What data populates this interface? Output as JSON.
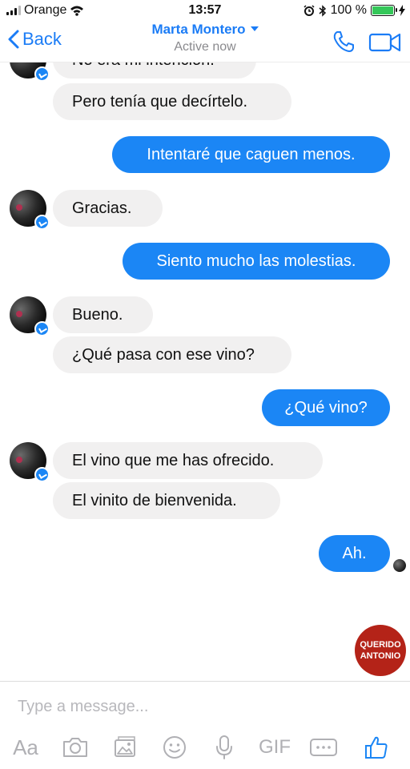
{
  "status_bar": {
    "carrier": "Orange",
    "time": "13:57",
    "battery": "100 %"
  },
  "header": {
    "back_label": "Back",
    "contact_name": "Marta Montero",
    "status": "Active now"
  },
  "messages": [
    {
      "side": "in",
      "text": "No era mi intención."
    },
    {
      "side": "in",
      "text": "Pero tenía que decírtelo."
    },
    {
      "side": "out",
      "text": "Intentaré que caguen menos."
    },
    {
      "side": "in",
      "text": "Gracias."
    },
    {
      "side": "out",
      "text": "Siento mucho las molestias."
    },
    {
      "side": "in",
      "text": "Bueno."
    },
    {
      "side": "in",
      "text": "¿Qué pasa con ese vino?"
    },
    {
      "side": "out",
      "text": "¿Qué vino?"
    },
    {
      "side": "in",
      "text": "El vino que me has ofrecido."
    },
    {
      "side": "in",
      "text": "El vinito de bienvenida."
    },
    {
      "side": "out",
      "text": "Ah."
    }
  ],
  "stamp": {
    "line1": "QUERIDO",
    "line2": "ANTONIO"
  },
  "composer": {
    "placeholder": "Type a message...",
    "text_label": "Aa",
    "gif_label": "GIF"
  },
  "colors": {
    "accent": "#1b7cf6",
    "outgoing_bubble": "#1b86f5",
    "incoming_bubble": "#f1f0f0",
    "stamp": "#b42318"
  },
  "icons": [
    "signal-icon",
    "wifi-icon",
    "alarm-icon",
    "bluetooth-icon",
    "battery-icon",
    "back-chevron-icon",
    "phone-icon",
    "video-camera-icon",
    "messenger-badge-icon",
    "camera-icon",
    "image-icon",
    "emoji-icon",
    "microphone-icon",
    "more-icon",
    "thumbs-up-icon"
  ]
}
